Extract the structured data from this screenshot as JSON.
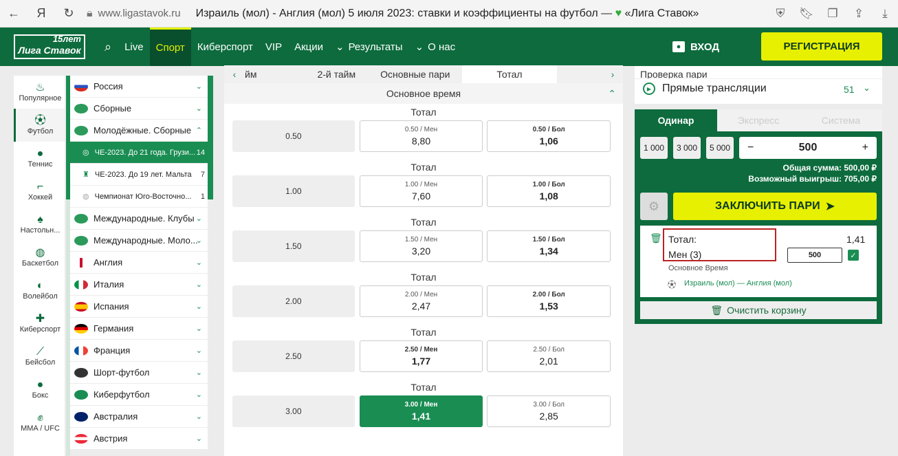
{
  "browser": {
    "url": "www.ligastavok.ru",
    "title": "Израиль (мол) - Англия (мол) 5 июля 2023: ставки и коэффициенты на футбол — ",
    "brand": "«Лига Ставок»"
  },
  "header": {
    "logo": "Лига Ставок",
    "logo_years": "15лет",
    "nav": [
      "Live",
      "Спорт",
      "Киберспорт",
      "VIP",
      "Акции",
      "Результаты",
      "О нас"
    ],
    "login": "ВХОД",
    "register": "РЕГИСТРАЦИЯ"
  },
  "sports": [
    "Популярное",
    "Футбол",
    "Теннис",
    "Хоккей",
    "Настольн...",
    "Баскетбол",
    "Волейбол",
    "Киберспорт",
    "Бейсбол",
    "Бокс",
    "MMA / UFC"
  ],
  "categories": [
    {
      "name": "Россия"
    },
    {
      "name": "Сборные"
    },
    {
      "name": "Молодёжные. Сборные"
    }
  ],
  "subcategories": [
    {
      "name": "ЧЕ-2023. До 21 года. Грузи...",
      "count": "14"
    },
    {
      "name": "ЧЕ-2023. До 19 лет. Мальта",
      "count": "7"
    },
    {
      "name": "Чемпионат Юго-Восточно...",
      "count": "1"
    }
  ],
  "categories2": [
    "Международные. Клубы",
    "Международные. Моло...",
    "Англия",
    "Италия",
    "Испания",
    "Германия",
    "Франция",
    "Шорт-футбол",
    "Киберфутбол",
    "Австралия",
    "Австрия"
  ],
  "tabs": [
    "йм",
    "2-й тайм",
    "Основные пари",
    "Тотал"
  ],
  "section": "Основное время",
  "market_title": "Тотал",
  "rows": [
    {
      "line": "0.50",
      "under_lbl": "0.50 / Мен",
      "under": "8,80",
      "over_lbl": "0.50 / Бол",
      "over": "1,06"
    },
    {
      "line": "1.00",
      "under_lbl": "1.00 / Мен",
      "under": "7,60",
      "over_lbl": "1.00 / Бол",
      "over": "1,08"
    },
    {
      "line": "1.50",
      "under_lbl": "1.50 / Мен",
      "under": "3,20",
      "over_lbl": "1.50 / Бол",
      "over": "1,34"
    },
    {
      "line": "2.00",
      "under_lbl": "2.00 / Мен",
      "under": "2,47",
      "over_lbl": "2.00 / Бол",
      "over": "1,53"
    },
    {
      "line": "2.50",
      "under_lbl": "2.50 / Мен",
      "under": "1,77",
      "over_lbl": "2.50 / Бол",
      "over": "2,01"
    },
    {
      "line": "3.00",
      "under_lbl": "3.00 / Мен",
      "under": "1,41",
      "over_lbl": "3.00 / Бол",
      "over": "2,85"
    }
  ],
  "right": {
    "check_label": "Проверка пари",
    "live": "Прямые трансляции",
    "live_count": "51"
  },
  "betslip": {
    "tabs": [
      "Одинар",
      "Экспресс",
      "Система"
    ],
    "quick": [
      "1 000",
      "3 000",
      "5 000"
    ],
    "amount": "500",
    "total": "Общая сумма: 500,00 ₽",
    "win": "Возможный выигрыш: 705,00 ₽",
    "place": "ЗАКЛЮЧИТЬ ПАРИ",
    "coupon": {
      "l1": "Тотал:",
      "l2": "Мен (3)",
      "odd": "1,41",
      "stake": "500",
      "sub": "Основное Время",
      "match": "Израиль (мол) — Англия (мол)"
    },
    "clear": "Очистить корзину"
  }
}
